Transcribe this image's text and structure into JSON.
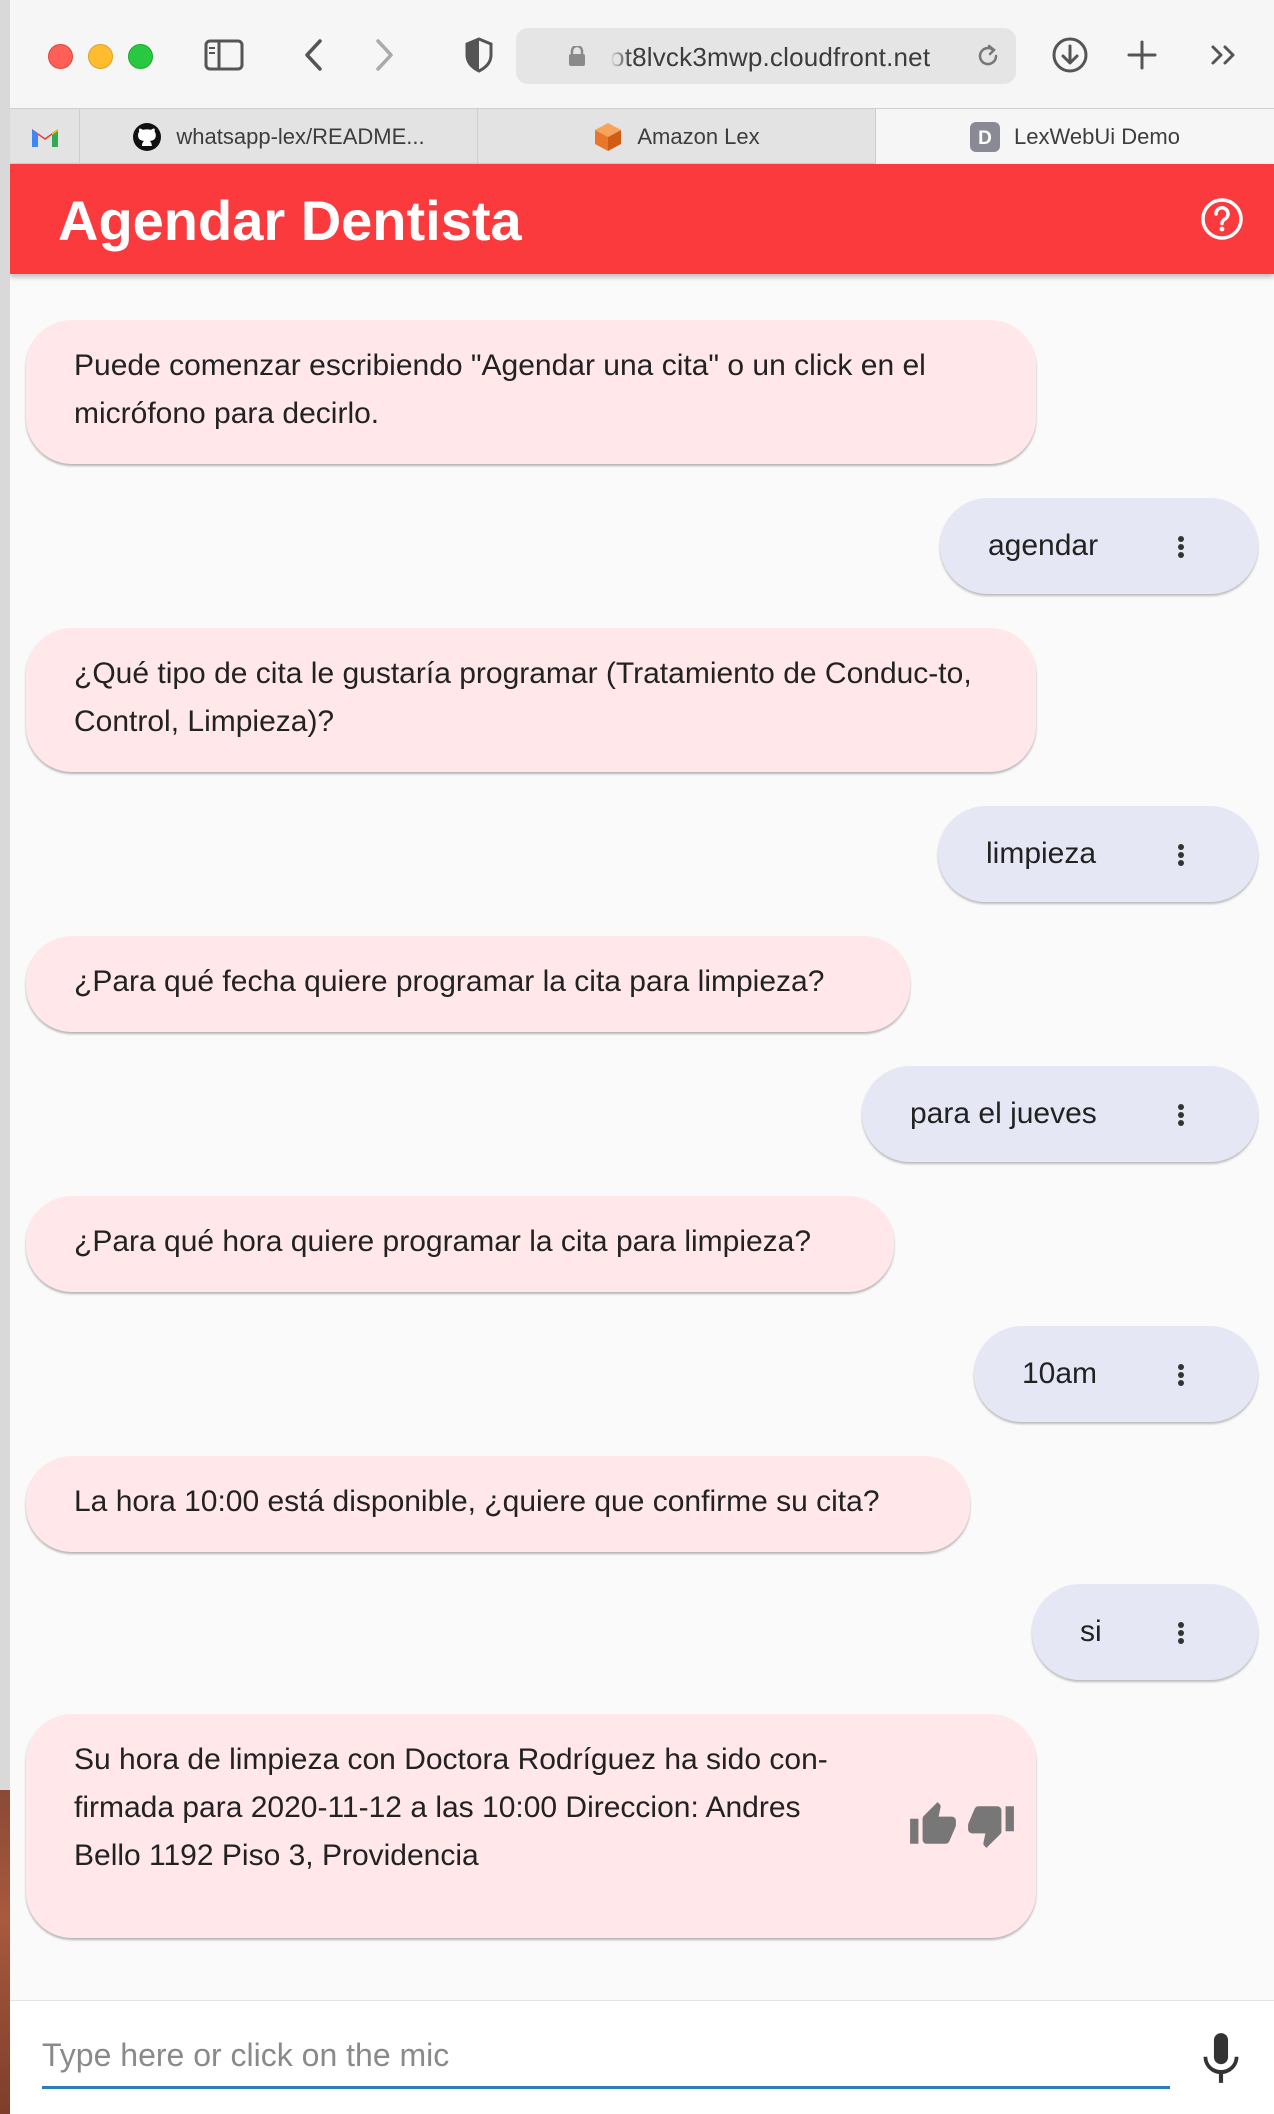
{
  "browser": {
    "url": "ot8lvck3mwp.cloudfront.net",
    "tabs": [
      {
        "label": "",
        "icon": "gmail-icon"
      },
      {
        "label": "whatsapp-lex/README...",
        "icon": "github-icon"
      },
      {
        "label": "Amazon Lex",
        "icon": "aws-cube-icon"
      },
      {
        "label": "LexWebUi Demo",
        "icon": "d-letter-icon",
        "favicon_letter": "D",
        "active": true
      }
    ]
  },
  "app": {
    "title": "Agendar Dentista",
    "header_color": "#fb3a3e"
  },
  "messages": [
    {
      "from": "bot",
      "text": "Puede comenzar escribiendo \"Agendar una cita\" o un click en el micrófono para decirlo."
    },
    {
      "from": "user",
      "text": "agendar"
    },
    {
      "from": "bot",
      "text": "¿Qué tipo de cita le gustaría programar (Tratamiento de Conduc-to, Control, Limpieza)?"
    },
    {
      "from": "user",
      "text": "limpieza"
    },
    {
      "from": "bot",
      "text": "¿Para qué fecha quiere programar la cita para limpieza?"
    },
    {
      "from": "user",
      "text": "para el jueves"
    },
    {
      "from": "bot",
      "text": "¿Para qué hora quiere programar la cita para limpieza?"
    },
    {
      "from": "user",
      "text": "10am"
    },
    {
      "from": "bot",
      "text": "La hora 10:00 está disponible, ¿quiere que confirme su cita?"
    },
    {
      "from": "user",
      "text": "si"
    },
    {
      "from": "bot",
      "text": "Su hora de limpieza con Doctora Rodríguez ha sido con-firmada para 2020-11-12 a las 10:00 Direccion: Andres Bello 1192 Piso 3, Providencia"
    }
  ],
  "input": {
    "placeholder": "Type here or click on the mic",
    "value": ""
  },
  "colors": {
    "bot_bubble": "#ffe7ea",
    "user_bubble": "#e5e8f4",
    "input_underline": "#2a7fb8"
  }
}
